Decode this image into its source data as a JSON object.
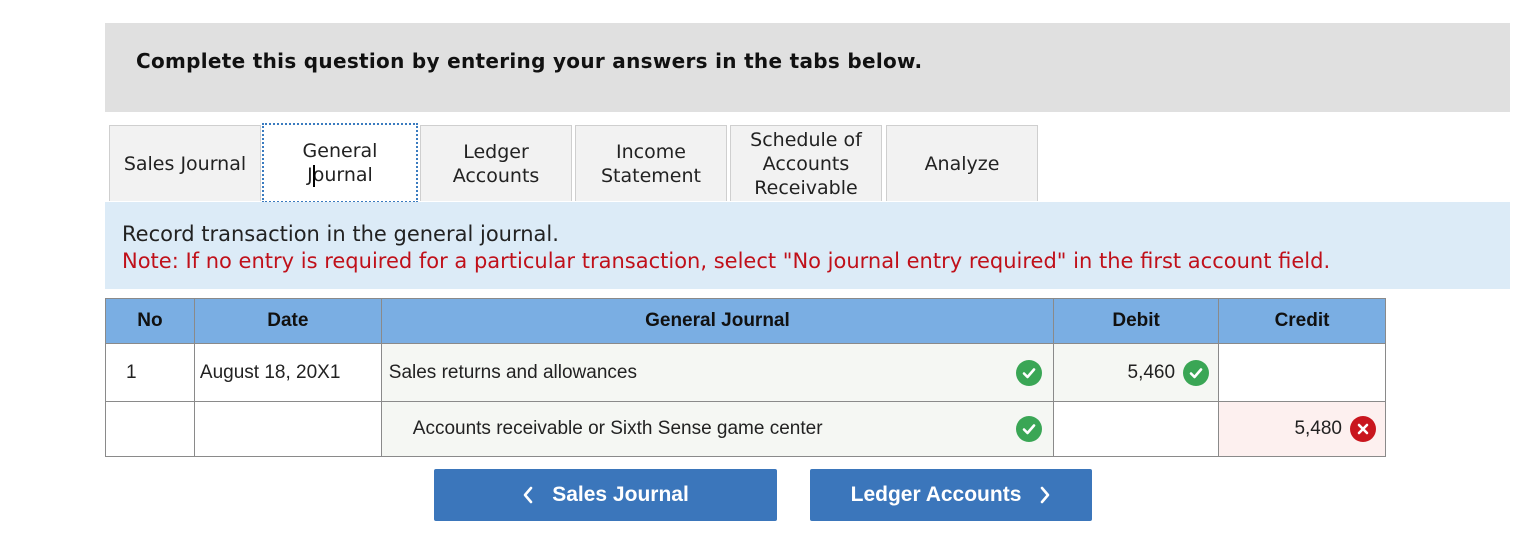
{
  "header": {
    "title": "Complete this question by entering your answers in the tabs below."
  },
  "tabs": [
    {
      "label": "Sales Journal",
      "active": false
    },
    {
      "label": "General\nJournal",
      "active": true
    },
    {
      "label": "Ledger\nAccounts",
      "active": false
    },
    {
      "label": "Income\nStatement",
      "active": false
    },
    {
      "label": "Schedule of\nAccounts\nReceivable",
      "active": false
    },
    {
      "label": "Analyze",
      "active": false
    }
  ],
  "instructions": {
    "text": "Record transaction in the general journal.",
    "note": "Note: If no entry is required for a particular transaction, select \"No journal entry required\" in the first account field."
  },
  "journal": {
    "headers": {
      "no": "No",
      "date": "Date",
      "account": "General Journal",
      "debit": "Debit",
      "credit": "Credit"
    },
    "rows": [
      {
        "no": "1",
        "date": "August 18, 20X1",
        "account": "Sales returns and allowances",
        "debit": "5,460",
        "credit": ""
      },
      {
        "no": "",
        "date": "",
        "account": "Accounts receivable or Sixth Sense game center",
        "debit": "",
        "credit": "5,480"
      }
    ]
  },
  "nav": {
    "prev_label": "Sales Journal",
    "next_label": "Ledger Accounts"
  },
  "colors": {
    "header_bg": "#e0e0e0",
    "instr_bg": "#dcebf7",
    "note_text": "#c0101a",
    "table_header": "#7aaee3",
    "button": "#3b76bb",
    "ok": "#3aa655",
    "error": "#c9161e"
  }
}
